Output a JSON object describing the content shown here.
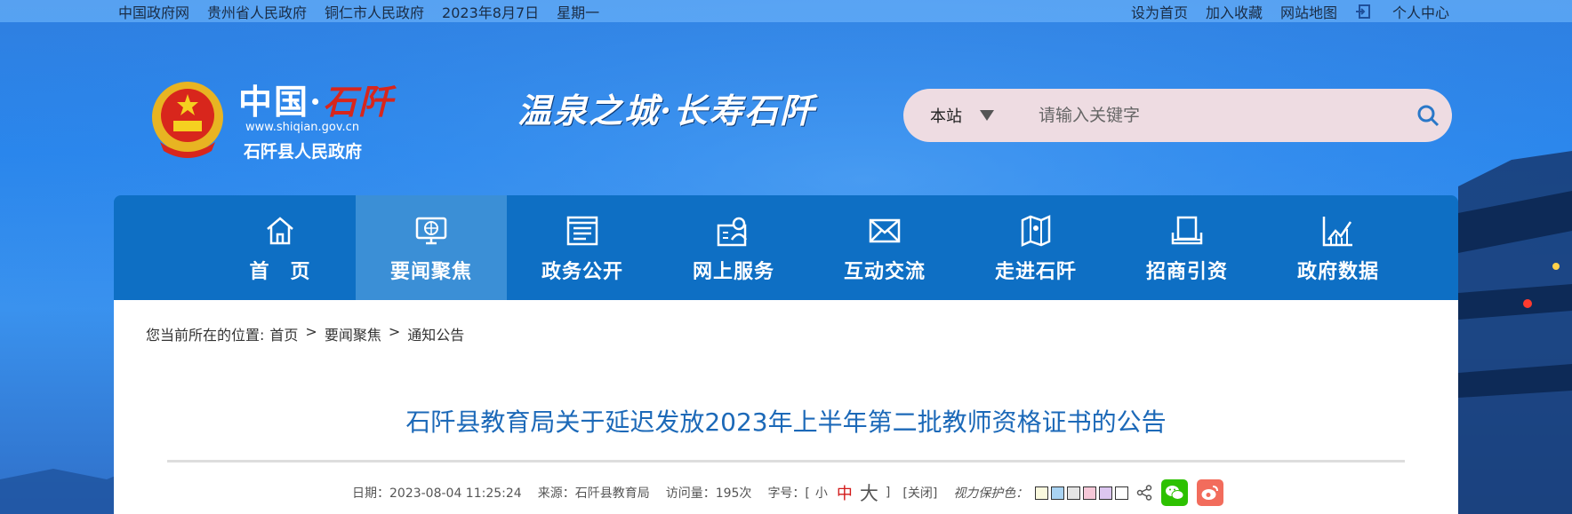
{
  "topbar": {
    "links_left": [
      "中国政府网",
      "贵州省人民政府",
      "铜仁市人民政府"
    ],
    "date": "2023年8月7日",
    "weekday": "星期一",
    "links_right": [
      "设为首页",
      "加入收藏",
      "网站地图"
    ],
    "personal_center": "个人中心"
  },
  "logo": {
    "china": "中国·",
    "county": "石阡",
    "url": "www.shiqian.gov.cn",
    "gov_name": "石阡县人民政府"
  },
  "slogan": "温泉之城·长寿石阡",
  "search": {
    "scope": "本站",
    "placeholder": "请输入关键字"
  },
  "nav": {
    "items": [
      {
        "label": "首　页",
        "icon": "home-icon"
      },
      {
        "label": "要闻聚焦",
        "icon": "globe-monitor-icon"
      },
      {
        "label": "政务公开",
        "icon": "document-list-icon"
      },
      {
        "label": "网上服务",
        "icon": "user-service-icon"
      },
      {
        "label": "互动交流",
        "icon": "mail-icon"
      },
      {
        "label": "走进石阡",
        "icon": "map-icon"
      },
      {
        "label": "招商引资",
        "icon": "briefcase-icon"
      },
      {
        "label": "政府数据",
        "icon": "chart-icon"
      }
    ],
    "active_index": 1
  },
  "breadcrumb": {
    "prefix": "您当前所在的位置:",
    "items": [
      "首页",
      "要闻聚焦",
      "通知公告"
    ],
    "separator": ">"
  },
  "article": {
    "title": "石阡县教育局关于延迟发放2023年上半年第二批教师资格证书的公告",
    "date_label": "日期：",
    "date": "2023-08-04 11:25:24",
    "source_label": "来源：",
    "source": "石阡县教育局",
    "views_label": "访问量：",
    "views": "195次",
    "fontsize_label": "字号：[",
    "fontsize_small": "小",
    "fontsize_medium": "中",
    "fontsize_large": "大",
    "fontsize_close": "]",
    "close": "[关闭]",
    "eye_label": "视力保护色："
  },
  "colors": {
    "nav_bg": "#0e6fc4",
    "nav_active": "#3b8fd6",
    "title": "#1c69b8",
    "swatches": [
      "#faf9de",
      "#cce8cf",
      "#e3edcd",
      "#fde6e0",
      "#dce2f1",
      "#ffffff"
    ]
  }
}
